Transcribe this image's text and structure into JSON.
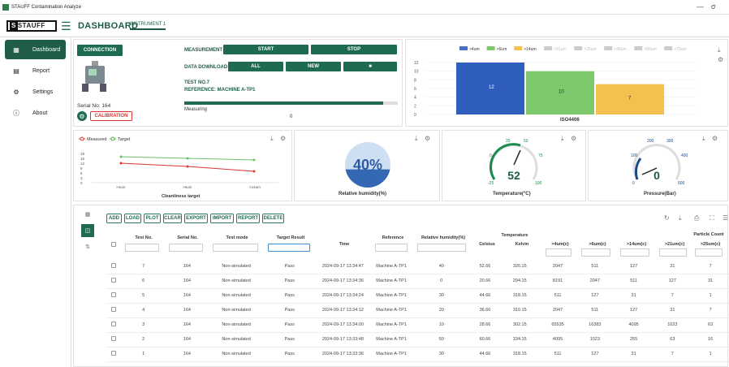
{
  "window": {
    "title": "STAUFF Contamination Analyze",
    "minimize": "—",
    "maximize": "σ"
  },
  "header": {
    "logo_text": "STAUFF",
    "title": "DASHBOARD",
    "tab": "INSTRUMENT 1"
  },
  "sidebar": {
    "items": [
      {
        "label": "Dashboard",
        "icon": "grid-icon",
        "glyph": "▦"
      },
      {
        "label": "Report",
        "icon": "document-icon",
        "glyph": "▤"
      },
      {
        "label": "Settings",
        "icon": "gear-icon",
        "glyph": "⚙"
      },
      {
        "label": "About",
        "icon": "info-icon",
        "glyph": "ⓘ"
      }
    ]
  },
  "connection": {
    "button": "CONNECTION",
    "serial": "Serial No: 164",
    "calibration": "CALIBRATION"
  },
  "measurement": {
    "label": "MEASUREMENT",
    "start": "START",
    "stop": "STOP",
    "download_label": "DATA DOWNLOAD",
    "all": "ALL",
    "new": "NEW",
    "delete_icon": "■",
    "test_no": "TEST NO.7",
    "reference": "REFERENCE: MACHINE A-TP1",
    "status": "Measuring",
    "progress_value": "0",
    "progress_fraction": 0.93
  },
  "iso_chart": {
    "legend": [
      ">4um",
      ">6um",
      ">14um",
      ">21um",
      ">25um",
      ">38um",
      ">50um",
      ">70um"
    ],
    "legend_colors": [
      "#4a6fc9",
      "#7dc96b",
      "#f4c14f",
      "#cccccc",
      "#cccccc",
      "#cccccc",
      "#cccccc",
      "#cccccc"
    ],
    "y_ticks": [
      "12",
      "10",
      "8",
      "6",
      "4",
      "2",
      "0"
    ],
    "xlabel": "ISO4406",
    "bars": [
      {
        "value": 12,
        "label": "12",
        "color": "#2f5ebc"
      },
      {
        "value": 10,
        "label": "10",
        "color": "#7dc96b"
      },
      {
        "value": 7,
        "label": "7",
        "color": "#f4c14f"
      }
    ],
    "ymax": 12
  },
  "cleanliness": {
    "legend_measured": "Measured",
    "legend_target": "Target",
    "y_ticks": [
      "18",
      "15",
      "12",
      "9",
      "6",
      "3",
      "0"
    ],
    "x_ticks": [
      ">4um",
      ">6um",
      ">14um"
    ],
    "xlabel": "Cleanliness target",
    "measured": [
      12,
      10,
      7
    ],
    "target": [
      16,
      15,
      14
    ]
  },
  "humidity": {
    "value": "40%",
    "label": "Relative humidity(%)",
    "fraction": 0.4
  },
  "temperature": {
    "value": "52",
    "label": "Temperature(°C)",
    "ticks": [
      "0",
      "25",
      "50",
      "75",
      "100",
      "-25"
    ]
  },
  "pressure": {
    "value": "0",
    "label": "Pressure(Bar)",
    "ticks": [
      "100",
      "200",
      "300",
      "400",
      "500",
      "0"
    ]
  },
  "toolbar": [
    "ADD",
    "LOAD",
    "PLOT",
    "CLEAR",
    "EXPORT",
    "IMPORT",
    "REPORT",
    "DELETE"
  ],
  "table": {
    "headers": [
      "Test No.",
      "Serial No.",
      "Test mode",
      "Target Result",
      "Time",
      "Reference",
      "Relative humidity(%)",
      "Celsius",
      "Kelvin",
      ">4um(c)",
      ">6um(c)",
      ">14um(c)",
      ">21um(c)",
      ">25um(c)"
    ],
    "group_temp": "Temperature",
    "group_particle": "Particle Count",
    "rows": [
      [
        "7",
        "164",
        "Non-simulated",
        "Pass",
        "2024-09-17 13:34:47",
        "Machine A-TP1",
        "40",
        "52.66",
        "326.15",
        "2047",
        "511",
        "127",
        "31",
        "7"
      ],
      [
        "6",
        "164",
        "Non-simulated",
        "Pass",
        "2024-09-17 13:34:36",
        "Machine A-TP1",
        "0",
        "20.66",
        "294.15",
        "8191",
        "2047",
        "511",
        "127",
        "31"
      ],
      [
        "5",
        "164",
        "Non-simulated",
        "Pass",
        "2024-09-17 13:34:24",
        "Machine A-TP1",
        "30",
        "44.66",
        "318.15",
        "511",
        "127",
        "31",
        "7",
        "1"
      ],
      [
        "4",
        "164",
        "Non-simulated",
        "Pass",
        "2024-09-17 13:34:12",
        "Machine A-TP1",
        "20",
        "36.66",
        "310.15",
        "2047",
        "511",
        "127",
        "31",
        "7"
      ],
      [
        "3",
        "164",
        "Non-simulated",
        "Pass",
        "2024-09-17 13:34:00",
        "Machine A-TP1",
        "10",
        "28.66",
        "302.15",
        "65535",
        "16383",
        "4095",
        "1023",
        "63"
      ],
      [
        "2",
        "164",
        "Non-simulated",
        "Pass",
        "2024-09-17 13:33:48",
        "Machine A-TP1",
        "50",
        "60.66",
        "334.15",
        "4095",
        "1023",
        "255",
        "63",
        "16"
      ],
      [
        "1",
        "164",
        "Non-simulated",
        "Pass",
        "2024-09-17 13:33:36",
        "Machine A-TP1",
        "30",
        "44.66",
        "318.15",
        "511",
        "127",
        "31",
        "7",
        "1"
      ]
    ]
  }
}
